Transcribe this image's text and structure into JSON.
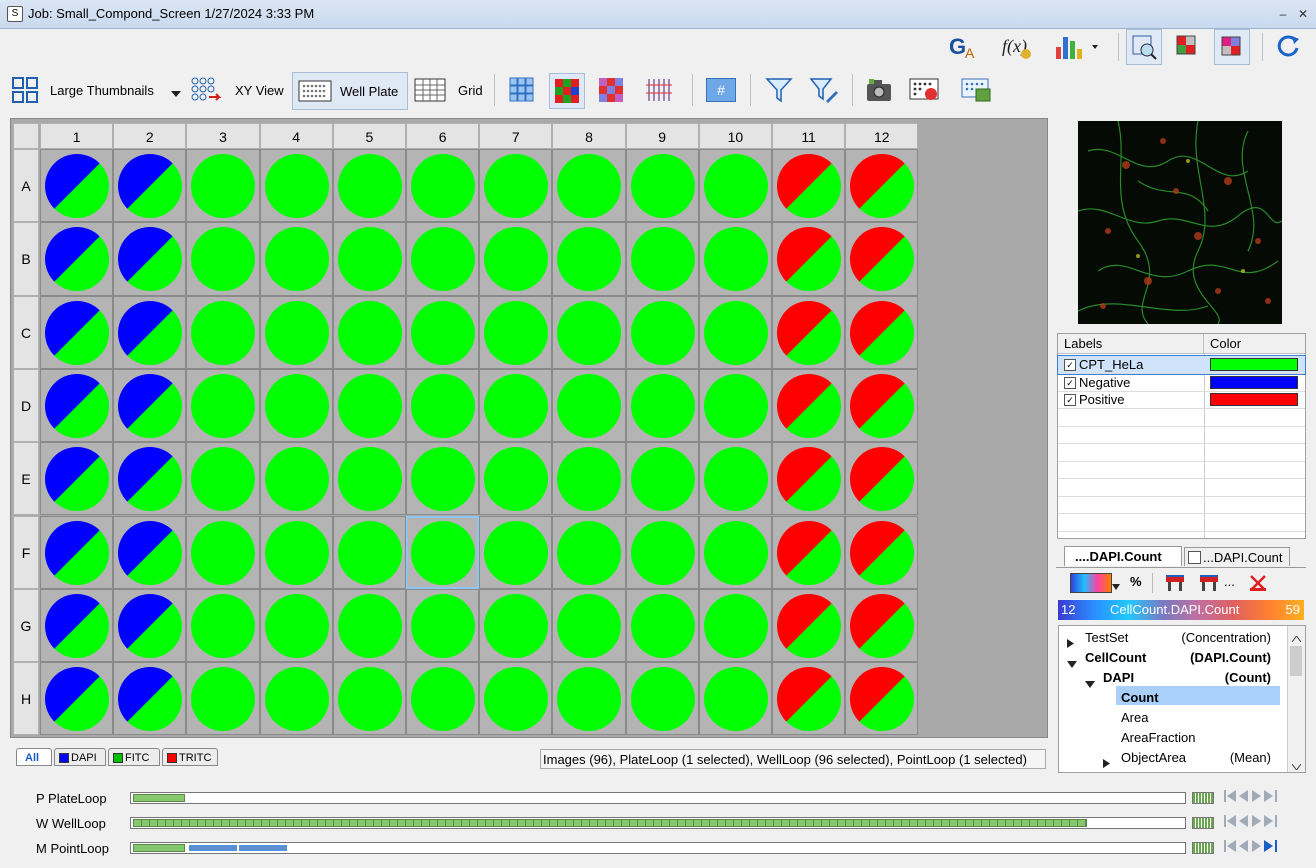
{
  "window": {
    "title": "Job: Small_Compond_Screen 1/27/2024 3:33 PM"
  },
  "toolbar": {
    "view_mode": "Large Thumbnails",
    "xy_view": "XY View",
    "well_plate": "Well Plate",
    "grid": "Grid",
    "number_sign": "#"
  },
  "plate": {
    "columns": [
      "1",
      "2",
      "3",
      "4",
      "5",
      "6",
      "7",
      "8",
      "9",
      "10",
      "11",
      "12"
    ],
    "rows": [
      "A",
      "B",
      "C",
      "D",
      "E",
      "F",
      "G",
      "H"
    ],
    "colors": {
      "green": "#00ff00",
      "blue": "#0000ff",
      "red": "#ff0000"
    },
    "column_types": [
      "Negative",
      "Negative",
      "CPT_HeLa",
      "CPT_HeLa",
      "CPT_HeLa",
      "CPT_HeLa",
      "CPT_HeLa",
      "CPT_HeLa",
      "CPT_HeLa",
      "CPT_HeLa",
      "Positive",
      "Positive"
    ],
    "selected_well": "F6"
  },
  "labels_panel": {
    "header_labels": "Labels",
    "header_color": "Color",
    "items": [
      {
        "label": "CPT_HeLa",
        "color": "#00ff00",
        "checked": true
      },
      {
        "label": "Negative",
        "color": "#0000ff",
        "checked": true
      },
      {
        "label": "Positive",
        "color": "#ff0000",
        "checked": true
      }
    ]
  },
  "measure_tabs": {
    "tab1": "....DAPI.Count",
    "tab2": "...DAPI.Count"
  },
  "scale": {
    "min": "12",
    "name": "CellCount.DAPI.Count",
    "max": "59",
    "percent": "%",
    "ellipsis": "..."
  },
  "tree": [
    {
      "label": "TestSet",
      "value": "(Concentration)",
      "bold": false
    },
    {
      "label": "CellCount",
      "value": "(DAPI.Count)",
      "bold": true
    },
    {
      "label": "DAPI",
      "value": "(Count)",
      "bold": true
    },
    {
      "label": "Count",
      "value": "",
      "bold": true
    },
    {
      "label": "Area",
      "value": "",
      "bold": false
    },
    {
      "label": "AreaFraction",
      "value": "",
      "bold": false
    },
    {
      "label": "ObjectArea",
      "value": "(Mean)",
      "bold": false
    }
  ],
  "channel_tabs": [
    {
      "label": "All",
      "color": ""
    },
    {
      "label": "DAPI",
      "color": "#0000ff"
    },
    {
      "label": "FITC",
      "color": "#00c000"
    },
    {
      "label": "TRITC",
      "color": "#ff0000"
    }
  ],
  "status": "Images (96),  PlateLoop (1 selected),  WellLoop (96 selected),  PointLoop (1 selected)",
  "loops": [
    {
      "label": "P  PlateLoop"
    },
    {
      "label": "W  WellLoop"
    },
    {
      "label": "M  PointLoop"
    }
  ]
}
